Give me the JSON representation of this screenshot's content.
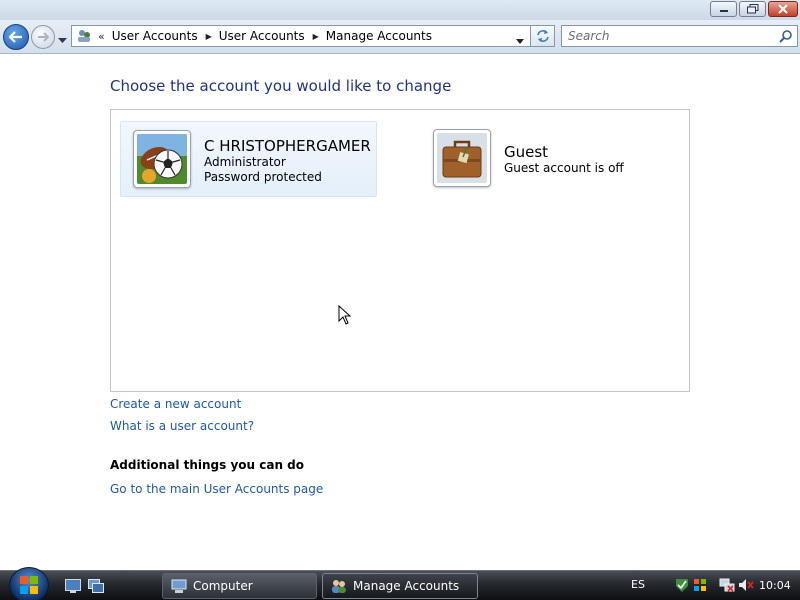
{
  "window": {
    "controls": {
      "minimize": "minimize",
      "maximize": "maximize",
      "close": "close"
    }
  },
  "address_bar": {
    "overflow": "«",
    "breadcrumbs": [
      "User Accounts",
      "User Accounts",
      "Manage Accounts"
    ]
  },
  "search": {
    "placeholder": "Search"
  },
  "main": {
    "title": "Choose the account you would like to change",
    "accounts": [
      {
        "name": "C HRISTOPHERGAMER",
        "lines": [
          "Administrator",
          "Password protected"
        ],
        "picture": "sports-balls-icon",
        "selected": true
      },
      {
        "name": "Guest",
        "lines": [
          "Guest account is off"
        ],
        "picture": "suitcase-icon",
        "selected": false
      }
    ],
    "links": {
      "create": "Create a new account",
      "what_is": "What is a user account?"
    },
    "additional": {
      "heading": "Additional things you can do",
      "links": [
        "Go to the main User Accounts page"
      ]
    }
  },
  "taskbar": {
    "buttons": [
      {
        "label": "Computer",
        "icon": "computer-icon",
        "active": false
      },
      {
        "label": "Manage Accounts",
        "icon": "users-icon",
        "active": true
      }
    ],
    "language": "ES",
    "clock": "10:04"
  },
  "colors": {
    "link": "#1e58a8",
    "title": "#1e3287",
    "selection": "#e4eff9"
  }
}
